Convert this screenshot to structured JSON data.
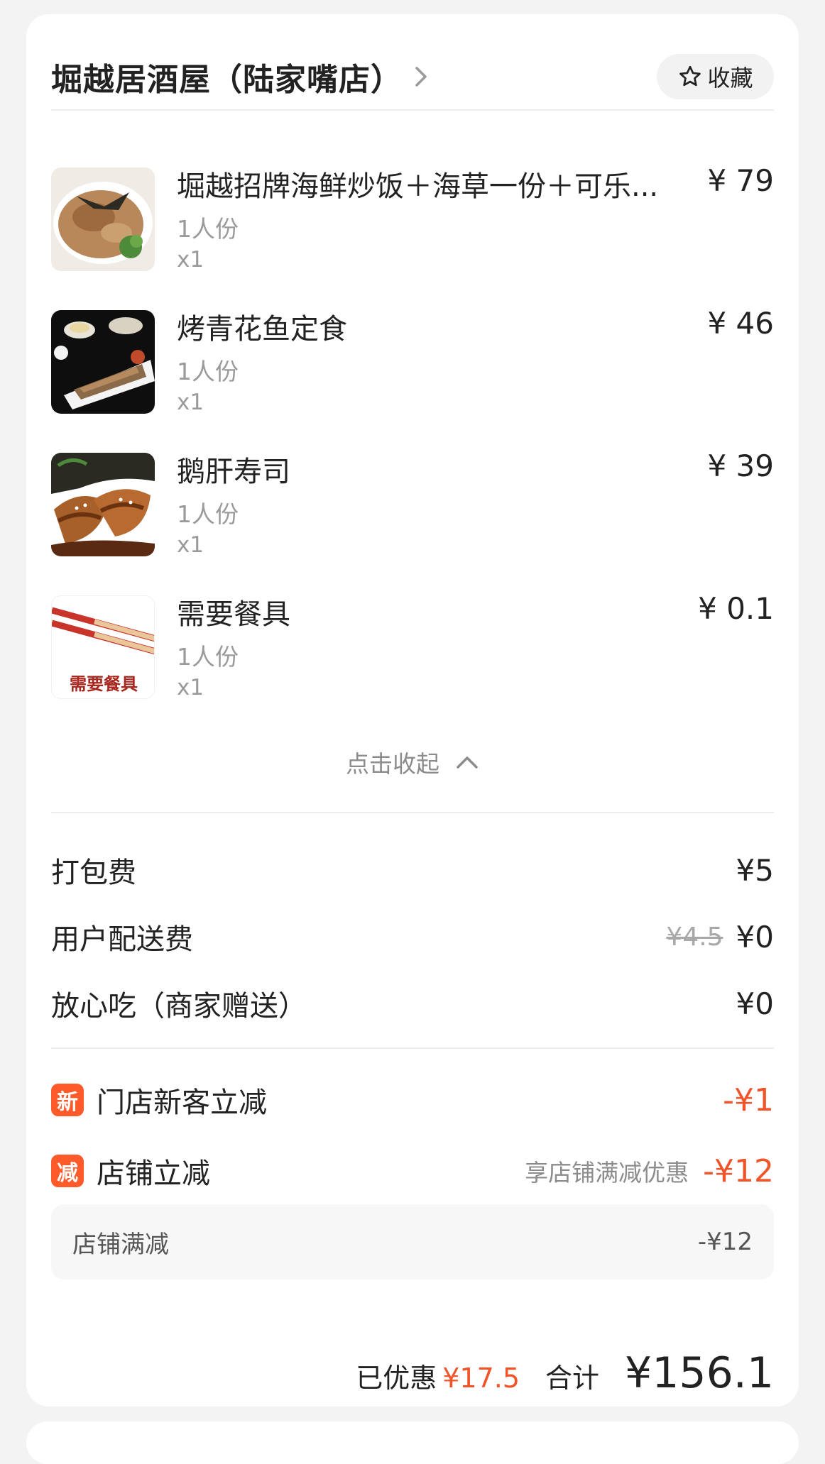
{
  "shop": {
    "name": "堀越居酒屋（陆家嘴店）",
    "favorite_label": "收藏"
  },
  "items": [
    {
      "name": "堀越招牌海鲜炒饭＋海草一份＋可乐...",
      "price": "¥ 79",
      "spec": "1人份",
      "qty": "x1",
      "thumb": "fried-rice-image"
    },
    {
      "name": "烤青花鱼定食",
      "price": "¥ 46",
      "spec": "1人份",
      "qty": "x1",
      "thumb": "grilled-mackerel-image"
    },
    {
      "name": "鹅肝寿司",
      "price": "¥ 39",
      "spec": "1人份",
      "qty": "x1",
      "thumb": "foie-gras-sushi-image"
    },
    {
      "name": "需要餐具",
      "price": "¥ 0.1",
      "spec": "1人份",
      "qty": "x1",
      "thumb": "utensils-image",
      "thumb_text": "需要餐具"
    }
  ],
  "collapse_label": "点击收起",
  "fees": {
    "packing": {
      "label": "打包费",
      "value": "¥5"
    },
    "delivery": {
      "label": "用户配送费",
      "original": "¥4.5",
      "value": "¥0"
    },
    "assurance": {
      "label": "放心吃（商家赠送）",
      "value": "¥0"
    }
  },
  "promos": {
    "new_customer": {
      "tag": "新",
      "label": "门店新客立减",
      "value": "-¥1"
    },
    "shop_discount": {
      "tag": "减",
      "label": "店铺立减",
      "note": "享店铺满减优惠",
      "value": "-¥12"
    },
    "shop_full_reduction": {
      "label": "店铺满减",
      "value": "-¥12"
    }
  },
  "summary": {
    "saved_label": "已优惠",
    "saved_value": "¥17.5",
    "total_label": "合计",
    "total_value": "¥156.1"
  },
  "colors": {
    "accent_red": "#f2542a",
    "tag_orange": "#ff5a2a"
  }
}
